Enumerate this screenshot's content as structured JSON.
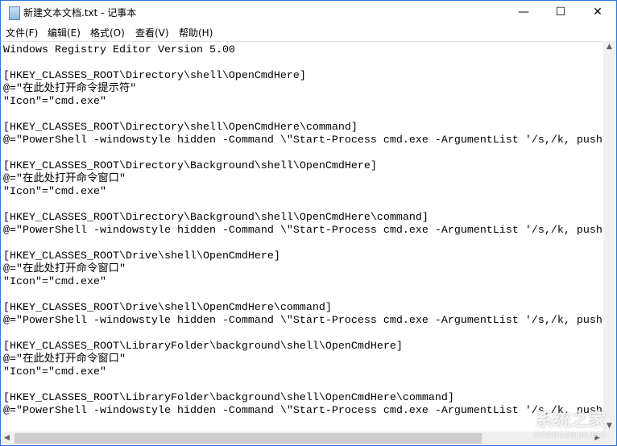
{
  "window": {
    "title": "新建文本文档.txt - 记事本",
    "minimize": "—",
    "maximize": "☐",
    "close": "✕"
  },
  "menu": [
    "文件(F)",
    "编辑(E)",
    "格式(O)",
    "查看(V)",
    "帮助(H)"
  ],
  "lines": [
    "Windows Registry Editor Version 5.00",
    "",
    "[HKEY_CLASSES_ROOT\\Directory\\shell\\OpenCmdHere]",
    "@=\"在此处打开命令提示符\"",
    "\"Icon\"=\"cmd.exe\"",
    "",
    "[HKEY_CLASSES_ROOT\\Directory\\shell\\OpenCmdHere\\command]",
    "@=\"PowerShell -windowstyle hidden -Command \\\"Start-Process cmd.exe -ArgumentList '/s,/k, push",
    "",
    "[HKEY_CLASSES_ROOT\\Directory\\Background\\shell\\OpenCmdHere]",
    "@=\"在此处打开命令窗口\"",
    "\"Icon\"=\"cmd.exe\"",
    "",
    "[HKEY_CLASSES_ROOT\\Directory\\Background\\shell\\OpenCmdHere\\command]",
    "@=\"PowerShell -windowstyle hidden -Command \\\"Start-Process cmd.exe -ArgumentList '/s,/k, push",
    "",
    "[HKEY_CLASSES_ROOT\\Drive\\shell\\OpenCmdHere]",
    "@=\"在此处打开命令窗口\"",
    "\"Icon\"=\"cmd.exe\"",
    "",
    "[HKEY_CLASSES_ROOT\\Drive\\shell\\OpenCmdHere\\command]",
    "@=\"PowerShell -windowstyle hidden -Command \\\"Start-Process cmd.exe -ArgumentList '/s,/k, push",
    "",
    "[HKEY_CLASSES_ROOT\\LibraryFolder\\background\\shell\\OpenCmdHere]",
    "@=\"在此处打开命令窗口\"",
    "\"Icon\"=\"cmd.exe\"",
    "",
    "[HKEY_CLASSES_ROOT\\LibraryFolder\\background\\shell\\OpenCmdHere\\command]",
    "@=\"PowerShell -windowstyle hidden -Command \\\"Start-Process cmd.exe -ArgumentList '/s,/k, push"
  ],
  "watermark": {
    "main": "系统之家",
    "sub": "XITONGZHIJIA.NET"
  }
}
